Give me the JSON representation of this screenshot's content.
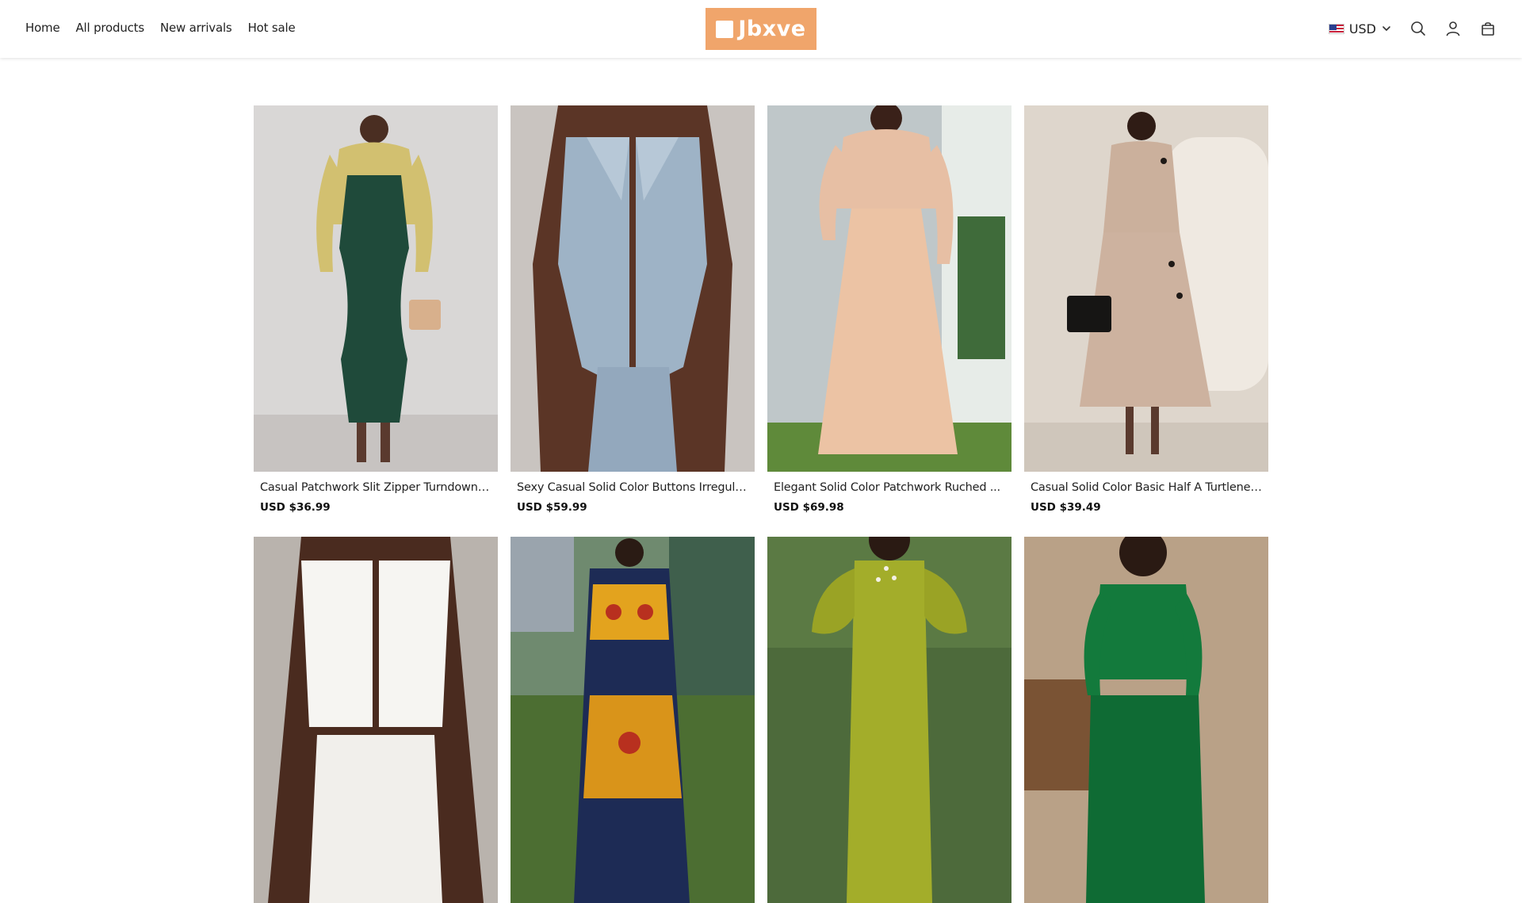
{
  "nav": {
    "items": [
      "Home",
      "All products",
      "New arrivals",
      "Hot sale"
    ]
  },
  "logo": {
    "text": "Jbxve",
    "color": "#f0a56b"
  },
  "currency": {
    "code": "USD"
  },
  "icons": [
    "search-icon",
    "account-icon",
    "cart-icon",
    "chevron-down-icon"
  ],
  "products": [
    {
      "name": "Casual Patchwork Slit Zipper Turndown ...",
      "price": "USD $36.99"
    },
    {
      "name": "Sexy Casual Solid Color Buttons Irregula...",
      "price": "USD $59.99"
    },
    {
      "name": "Elegant Solid Color Patchwork Ruched ...",
      "price": "USD $69.98"
    },
    {
      "name": "Casual Solid Color Basic Half A Turtlenec...",
      "price": "USD $39.49"
    },
    {
      "name": "",
      "price": ""
    },
    {
      "name": "",
      "price": ""
    },
    {
      "name": "",
      "price": ""
    },
    {
      "name": "",
      "price": ""
    }
  ]
}
